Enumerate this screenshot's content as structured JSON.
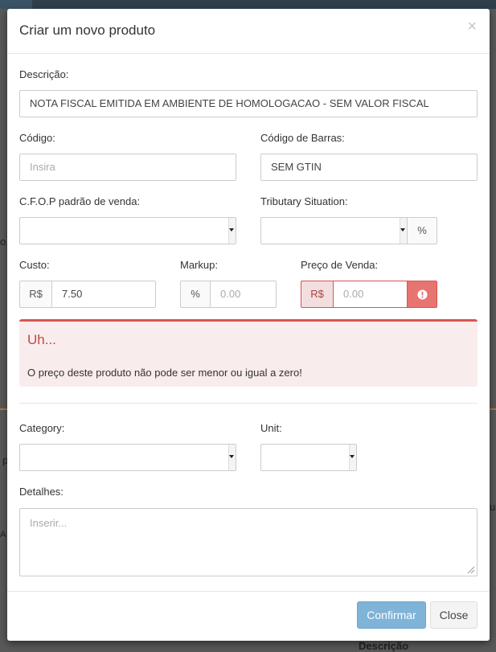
{
  "modal": {
    "title": "Criar um novo produto",
    "close_glyph": "×"
  },
  "form": {
    "descricao": {
      "label": "Descrição:",
      "value": "NOTA FISCAL EMITIDA EM AMBIENTE DE HOMOLOGACAO - SEM VALOR FISCAL"
    },
    "codigo": {
      "label": "Código:",
      "placeholder": "Insira"
    },
    "codigo_barras": {
      "label": "Código de Barras:",
      "value": "SEM GTIN"
    },
    "cfop": {
      "label": "C.F.O.P padrão de venda:",
      "value": ""
    },
    "tributary": {
      "label": "Tributary Situation:",
      "value": "",
      "addon": "%"
    },
    "custo": {
      "label": "Custo:",
      "addon": "R$",
      "value": "7.50"
    },
    "markup": {
      "label": "Markup:",
      "addon": "%",
      "placeholder": "0.00"
    },
    "preco": {
      "label": "Preço de Venda:",
      "addon": "R$",
      "placeholder": "0.00",
      "error_icon": "exclamation-circle-icon"
    },
    "category": {
      "label": "Category:",
      "value": ""
    },
    "unit": {
      "label": "Unit:",
      "value": ""
    },
    "detalhes": {
      "label": "Detalhes:",
      "placeholder": "Inserir..."
    }
  },
  "alert": {
    "title": "Uh...",
    "message": "O preço deste produto não pode ser menor ou igual a zero!"
  },
  "buttons": {
    "confirm": "Confirmar",
    "close": "Close"
  },
  "background": {
    "frag_left_1": "o",
    "frag_left_2": "p",
    "frag_left_3": "A",
    "frag_right_1": "ua",
    "frag_bottom": "Descrição"
  },
  "colors": {
    "danger": "#d9534f",
    "primary_disabled": "#7fb3d8"
  }
}
